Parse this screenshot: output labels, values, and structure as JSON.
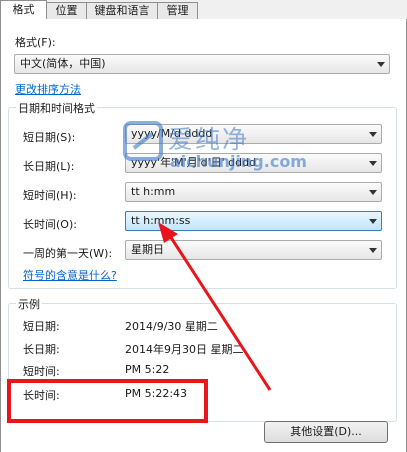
{
  "tabs": [
    {
      "label": "格式"
    },
    {
      "label": "位置"
    },
    {
      "label": "键盘和语言"
    },
    {
      "label": "管理"
    }
  ],
  "format": {
    "label": "格式(F):",
    "value": "中文(简体，中国)",
    "sort_link": "更改排序方法"
  },
  "datetime_group": {
    "title": "日期和时间格式",
    "short_date_label": "短日期(S):",
    "short_date_value": "yyyy/M/d dddd",
    "long_date_label": "长日期(L):",
    "long_date_value": "yyyy'年'M'月'd'日' dddd",
    "short_time_label": "短时间(H):",
    "short_time_value": "tt h:mm",
    "long_time_label": "长时间(O):",
    "long_time_value": "tt h:mm:ss",
    "first_day_label": "一周的第一天(W):",
    "first_day_value": "星期日",
    "symbols_link": "符号的含意是什么?"
  },
  "example_group": {
    "title": "示例",
    "short_date_label": "短日期:",
    "short_date_value": "2014/9/30 星期二",
    "long_date_label": "长日期:",
    "long_date_value": "2014年9月30日 星期二",
    "short_time_label": "短时间:",
    "short_time_value": "PM 5:22",
    "long_time_label": "长时间:",
    "long_time_value": "PM 5:22:43"
  },
  "buttons": {
    "other_settings": "其他设置(D)..."
  },
  "watermark": {
    "text": "爱纯净",
    "url": "aichunjing.com"
  },
  "colors": {
    "highlight_red": "#e8161b",
    "link_blue": "#0066cc"
  }
}
